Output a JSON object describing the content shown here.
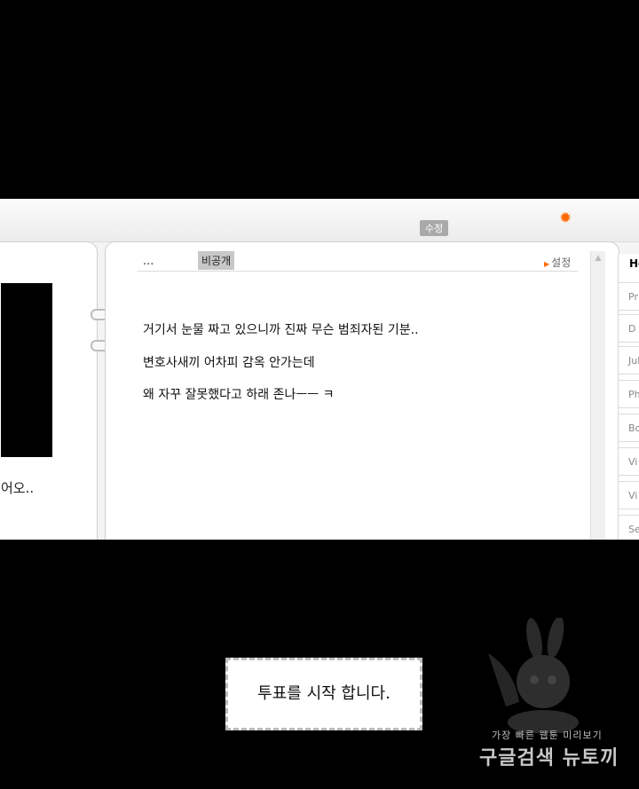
{
  "toolbar": {
    "edit_label": "수정",
    "gear_icon": "gear-icon",
    "accent_color": "#ff6a00"
  },
  "left_page": {
    "text": "어오.."
  },
  "post": {
    "header_dots": "...",
    "private_label": "비공개",
    "settings_label": "설정",
    "lines": [
      "거기서 눈물 짜고 있으니까 진짜 무슨 범죄자된 기분..",
      "변호사새끼 어차피 감옥 안가는데",
      "왜 자꾸 잘못했다고 하래 존나ㅡㅡ ㅋ"
    ]
  },
  "sidebar": {
    "header": "Ho",
    "items": [
      "Pr",
      "D",
      "Juk",
      "Ph",
      "Bo",
      "Vi",
      "Vi",
      "Se"
    ]
  },
  "vote": {
    "text": "투표를 시작 합니다."
  },
  "watermark": {
    "line1": "가장 빠른 웹툰 미리보기",
    "line2": "구글검색 뉴토끼"
  }
}
